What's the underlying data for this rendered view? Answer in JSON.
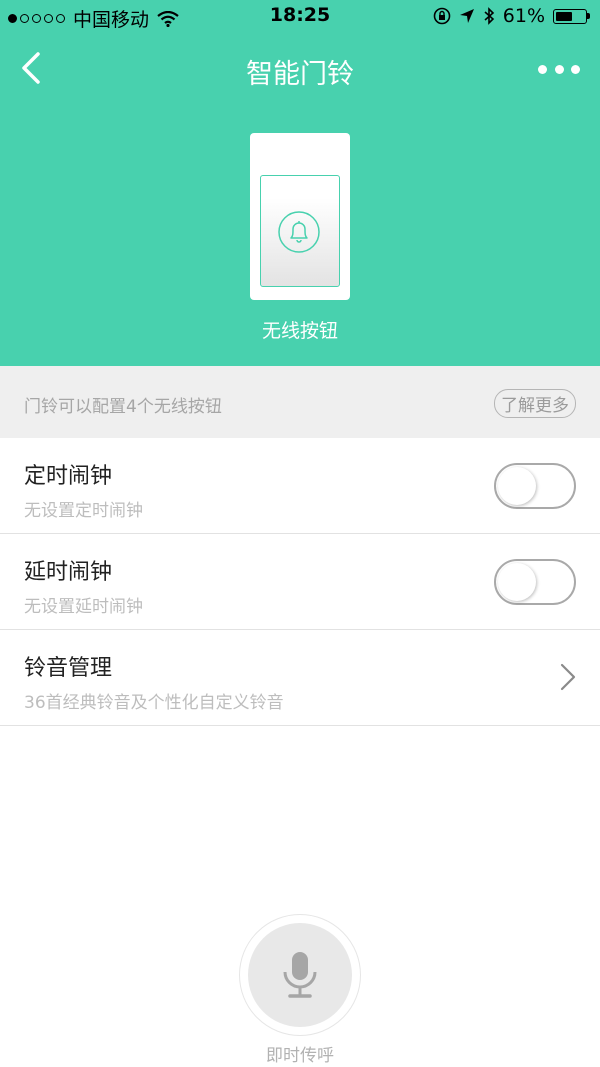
{
  "status_bar": {
    "carrier": "中国移动",
    "time": "18:25",
    "battery": "61%",
    "battery_level": 0.61,
    "signal_bars_filled": 1,
    "signal_bars_total": 5
  },
  "nav": {
    "title": "智能门铃",
    "back_icon": "chevron-left-icon",
    "more_icon": "more-dots-icon"
  },
  "device": {
    "label": "无线按钮",
    "icon": "bell-icon"
  },
  "info": {
    "text": "门铃可以配置4个无线按钮",
    "link": "了解更多"
  },
  "settings": [
    {
      "title": "定时闹钟",
      "subtitle": "无设置定时闹钟",
      "control": "toggle",
      "on": false
    },
    {
      "title": "延时闹钟",
      "subtitle": "无设置延时闹钟",
      "control": "toggle",
      "on": false
    },
    {
      "title": "铃音管理",
      "subtitle": "36首经典铃音及个性化自定义铃音",
      "control": "chevron"
    }
  ],
  "intercom": {
    "label": "即时传呼",
    "icon": "microphone-icon"
  },
  "colors": {
    "accent": "#48d1ae",
    "info_bg": "#efefef",
    "muted_text": "#bdbdbd"
  }
}
